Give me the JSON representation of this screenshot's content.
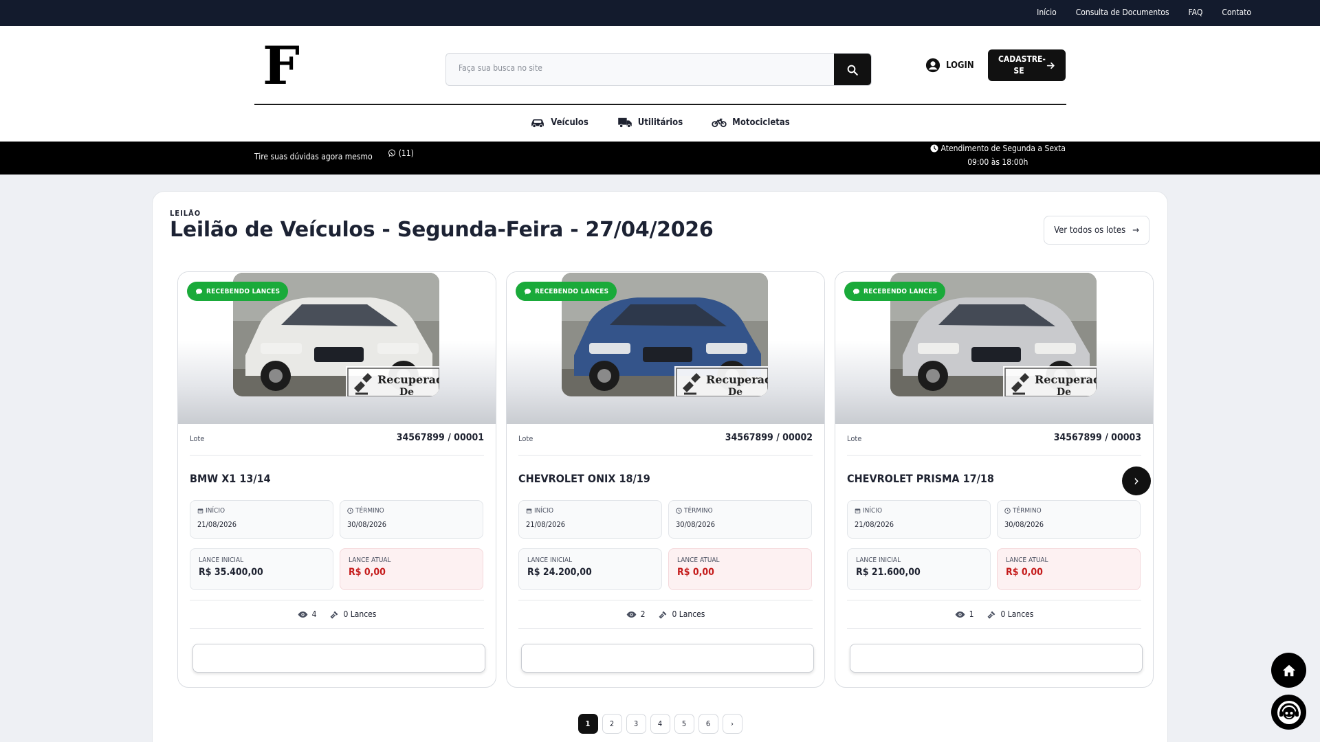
{
  "topbar": {
    "links": [
      "Início",
      "Consulta de Documentos",
      "FAQ",
      "Contato"
    ]
  },
  "header": {
    "logo": "F",
    "search_placeholder": "Faça sua busca no site",
    "login_label": "LOGIN",
    "signup_label": "CADASTRE-SE"
  },
  "categories": [
    {
      "label": "Veículos",
      "icon": "car-icon"
    },
    {
      "label": "Utilitários",
      "icon": "truck-icon"
    },
    {
      "label": "Motocicletas",
      "icon": "motorcycle-icon"
    }
  ],
  "infobar": {
    "help_text": "Tire suas dúvidas agora mesmo",
    "whatsapp_text": "(11)",
    "hours_line1": "Atendimento de Segunda a Sexta",
    "hours_line2": "09:00 às 18:00h"
  },
  "auction": {
    "kicker": "LEILÃO",
    "title": "Leilão de Veículos - Segunda-Feira - 27/04/2026",
    "view_all_label": "Ver todos os lotes",
    "view_all_arrow": "→"
  },
  "labels": {
    "status": "RECEBENDO LANCES",
    "lot": "Lote",
    "start": "INÍCIO",
    "end": "TÉRMINO",
    "initial_bid": "LANCE INICIAL",
    "current_bid": "LANCE ATUAL",
    "watermark_line1": "Recuperado",
    "watermark_line2": "De"
  },
  "lots": [
    {
      "lot_number": "34567899 / 00001",
      "name": "BMW X1 13/14",
      "start": "21/08/2026",
      "end": "30/08/2026",
      "initial_bid": "R$ 35.400,00",
      "current_bid": "R$ 0,00",
      "views": "4",
      "bids": "0 Lances",
      "car_color": "#e9e9e6"
    },
    {
      "lot_number": "34567899 / 00002",
      "name": "CHEVROLET ONIX 18/19",
      "start": "21/08/2026",
      "end": "30/08/2026",
      "initial_bid": "R$ 24.200,00",
      "current_bid": "R$ 0,00",
      "views": "2",
      "bids": "0 Lances",
      "car_color": "#34548a"
    },
    {
      "lot_number": "34567899 / 00003",
      "name": "CHEVROLET PRISMA 17/18",
      "start": "21/08/2026",
      "end": "30/08/2026",
      "initial_bid": "R$ 21.600,00",
      "current_bid": "R$ 0,00",
      "views": "1",
      "bids": "0 Lances",
      "car_color": "#c9cacd"
    }
  ],
  "carousel_next": "›",
  "pagination": {
    "pages": [
      "1",
      "2",
      "3",
      "4",
      "5",
      "6"
    ],
    "active": "1",
    "next": "›"
  },
  "colors": {
    "dark_nav": "#131b2d",
    "badge_green": "#1aaa3a",
    "current_bid_red": "#c41a1a"
  }
}
